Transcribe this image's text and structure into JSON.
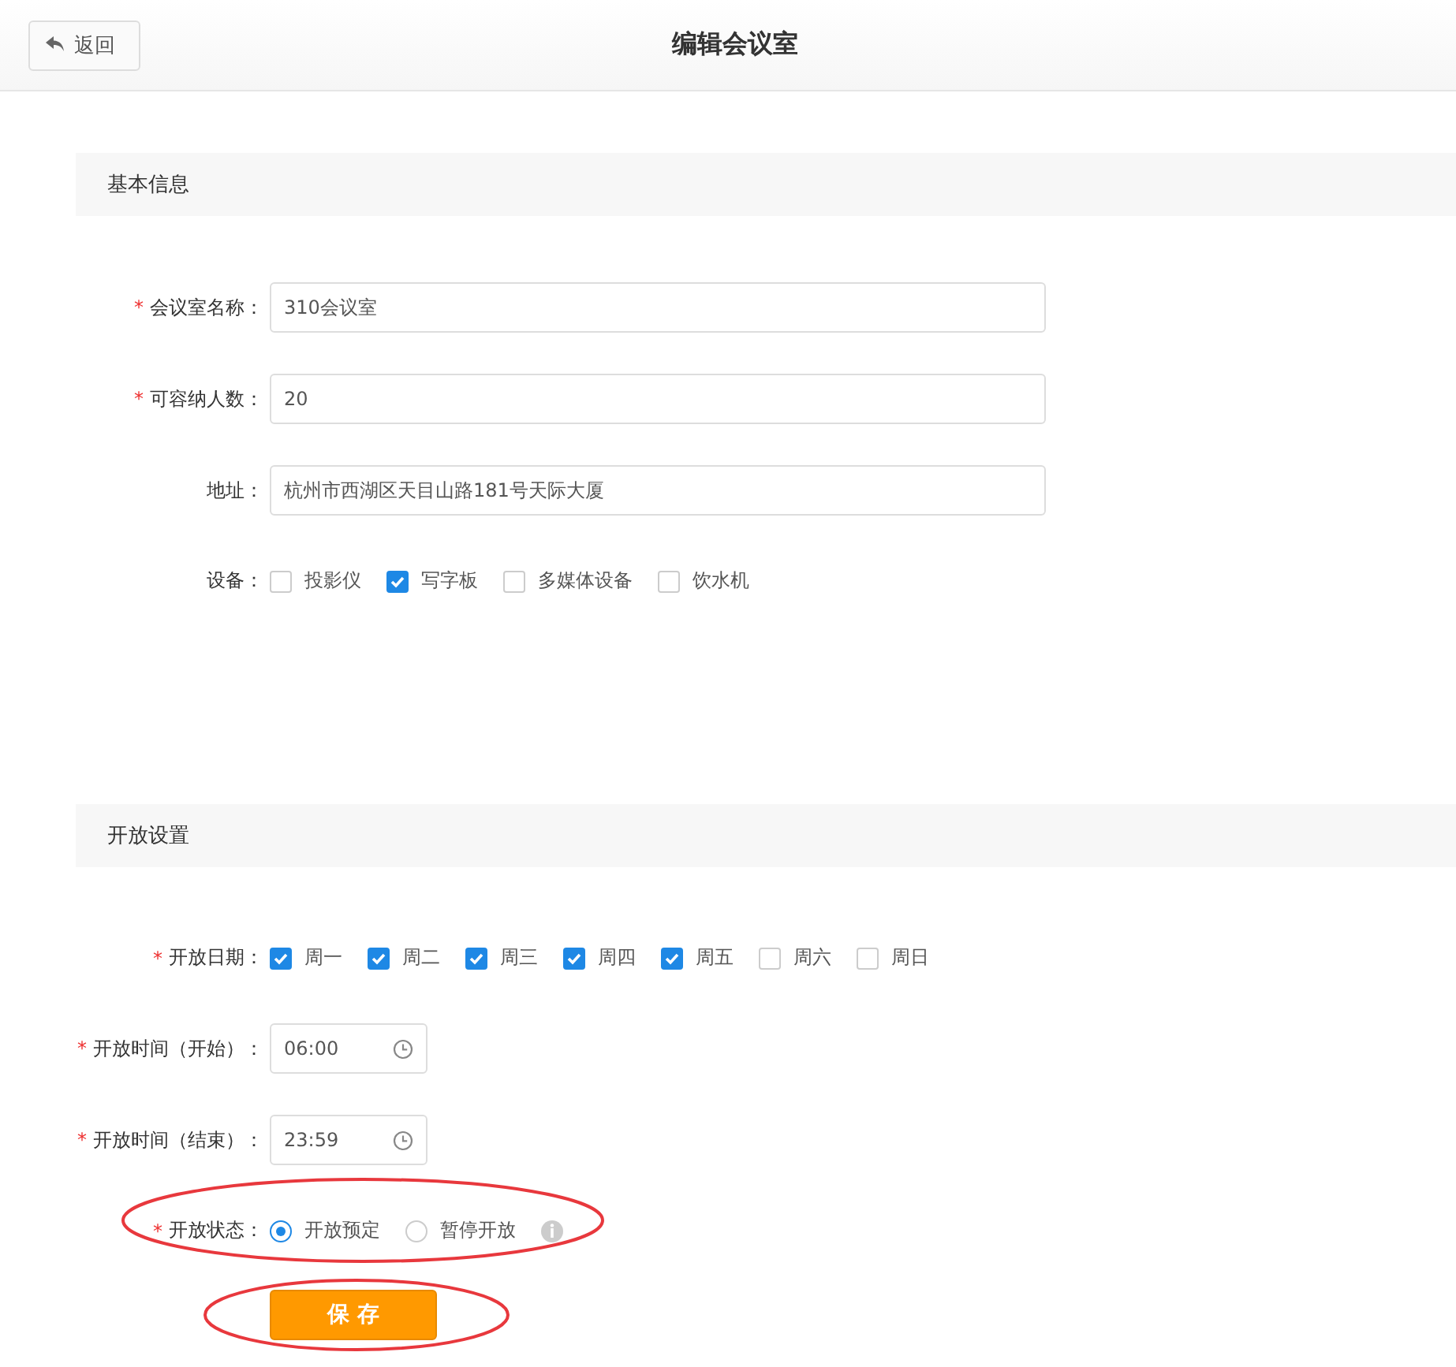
{
  "header": {
    "back_button": "返回",
    "title": "编辑会议室"
  },
  "sections": [
    {
      "title": "基本信息",
      "fields": [
        {
          "kind": "text",
          "label": "会议室名称：",
          "required_mark": "*",
          "value": "310会议室"
        },
        {
          "kind": "text",
          "label": "可容纳人数：",
          "required_mark": "*",
          "value": "20"
        },
        {
          "kind": "text",
          "label": "地址：",
          "value": "杭州市西湖区天目山路181号天际大厦"
        },
        {
          "kind": "checks",
          "label": "设备：",
          "options": [
            {
              "label": "投影仪",
              "checked": false
            },
            {
              "label": "写字板",
              "checked": true
            },
            {
              "label": "多媒体设备",
              "checked": false
            },
            {
              "label": "饮水机",
              "checked": false
            }
          ]
        }
      ]
    },
    {
      "title": "开放设置",
      "fields": [
        {
          "kind": "checks",
          "label": "开放日期：",
          "required_mark": "*",
          "options": [
            {
              "label": "周一",
              "checked": true
            },
            {
              "label": "周二",
              "checked": true
            },
            {
              "label": "周三",
              "checked": true
            },
            {
              "label": "周四",
              "checked": true
            },
            {
              "label": "周五",
              "checked": true
            },
            {
              "label": "周六",
              "checked": false
            },
            {
              "label": "周日",
              "checked": false
            }
          ]
        },
        {
          "kind": "time",
          "label": "开放时间（开始）：",
          "required_mark": "*",
          "value": "06:00"
        },
        {
          "kind": "time",
          "label": "开放时间（结束）：",
          "required_mark": "*",
          "value": "23:59"
        },
        {
          "kind": "radios",
          "label": "开放状态：",
          "required_mark": "*",
          "highlighted": true,
          "options": [
            {
              "label": "开放预定",
              "selected": true
            },
            {
              "label": "暂停开放",
              "selected": false
            }
          ]
        }
      ]
    }
  ],
  "save_button": {
    "label": "保 存",
    "highlighted": true
  }
}
